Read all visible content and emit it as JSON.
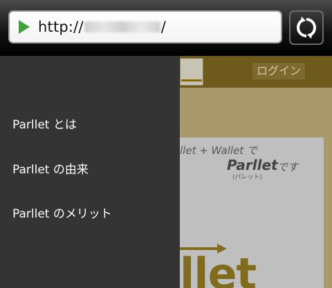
{
  "browser": {
    "url_prefix": "http://",
    "url_suffix": "/",
    "url_redacted_hint": "192.168.2.4",
    "play_icon": "play-icon",
    "refresh_icon": "refresh-icon"
  },
  "page": {
    "login_label": "ログイン",
    "tagline": "llet + Wallet で",
    "brand": "Parllet",
    "brand_suffix": "です",
    "brand_reading": "(パレット)",
    "big_logo": "llet"
  },
  "drawer": {
    "items": [
      {
        "label": "Parllet とは"
      },
      {
        "label": "Parllet の由来"
      },
      {
        "label": "Parllet のメリット"
      }
    ]
  },
  "colors": {
    "drawer_bg": "#343434",
    "page_header": "#6e5a1a",
    "page_bg": "#a99a6b",
    "accent_gold": "#7f6c1c"
  }
}
